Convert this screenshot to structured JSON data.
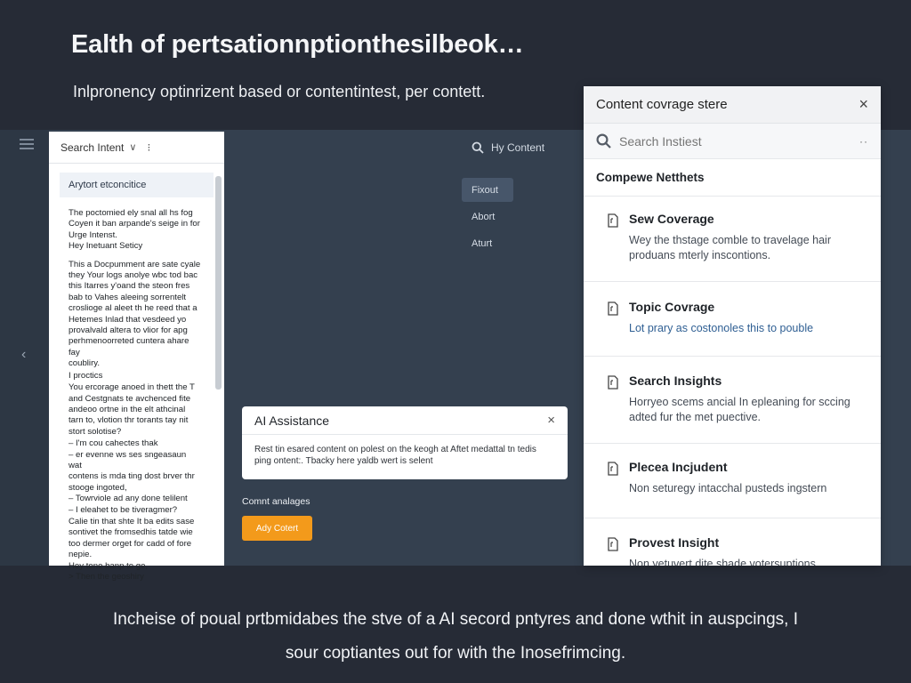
{
  "slide": {
    "title": "Ealth of pertsationnptionthesilbeok…",
    "subtitle": "Inlpronency optinrizent based or contentintest, per contett.",
    "caption_line1": "Incheise of poual prtbmidabes the stve of a AI secord pntyres and done wthit in auspcings, I",
    "caption_line2": "sour coptiantes out for with the Inosefrimcing."
  },
  "doc_panel": {
    "dropdown_label": "Search Intent",
    "dropdown_chevron": "∨",
    "kebab": "⁝",
    "section_label": "Arytort etconcitice",
    "paragraphs": [
      "The poctomied ely snal all hs fog\nCoyen it ban arpande's seige in for\nUrge Intenst.\nHey Inetuant Seticy",
      "This a Docpumment are sate cyale\nthey Your logs anolye wbc tod bac\nthis Itarres y'oand the steon fres\nbab to Vahes aleeing sorrentelt\ncroslioge al aleet th he reed that a\nHetemes Inlad that vesdeed yo\nprovalvald altera to vlior for apg\nperhmenoorreted cuntera ahare fay\ncoubliry.",
      "  I proctics",
      "You ercorage anoed in thett the T\nand Cestgnats te avchenced fite\nandeoo ortne in the elt athcinal\ntarn to, vlotion thr torants tay nit\nstort solotise?",
      "–  I'm cou cahectes thak\n–  er evenne ws ses sngeasaun wat\ncontens is mda ting dost brver thr\nstooge ingoted,\n–  Towrviole ad any done telilent\n–  I eleahet to be tiveragmer?",
      "Calie tin that shte It ba edits sase\nsontivet the fromsedhis tatde wie\ntoo dermer orget for cadd of fore\nnepie.\nHey tone banp to ge,\n>  Then the geoshiry"
    ]
  },
  "toolbar": {
    "search_label": "Hy Content"
  },
  "menu": {
    "items": [
      "Fixout",
      "Abort",
      "Aturt"
    ]
  },
  "ai_assistance": {
    "title": "AI Assistance",
    "close_glyph": "×",
    "body": "Rest tin esared content on polest on the keogh at Aftet medattal tn tedis ping ontent:. Tbacky here yaldb wert is selent"
  },
  "content_analysis": {
    "label": "Comnt analages",
    "button_label": "Ady Cotert"
  },
  "right_panel": {
    "title": "Content covrage stere",
    "close_glyph": "×",
    "search_placeholder": "Search Instiest",
    "search_more": "··",
    "section_title": "Compewe Netthets",
    "items": [
      {
        "title": "Sew Coverage",
        "desc": "Wey the thstage comble to travelage hair produans mterly inscontions."
      },
      {
        "title": "Topic Covrage",
        "desc": "Lot prary as costonoles this to pouble"
      },
      {
        "title": "Search Insights",
        "desc": "Horryeo scems ancial In epleaning for sccing adted fur the met puective."
      },
      {
        "title": "Plecea Incjudent",
        "desc": "Non seturegy intacchal pusteds ingstern"
      },
      {
        "title": "Provest Insight",
        "desc": "Non yetuvert dite shade votersuptions"
      }
    ]
  },
  "colors": {
    "background": "#262b36",
    "app_area": "#34404f",
    "accent_orange": "#f39a1b"
  }
}
